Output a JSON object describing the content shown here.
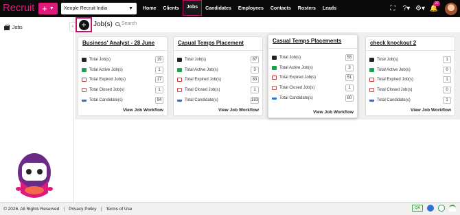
{
  "app": {
    "logo": "Recruit",
    "add_label": "+",
    "org": "Xeople Recruit India"
  },
  "nav": [
    "Home",
    "Clients",
    "Jobs",
    "Candidates",
    "Employees",
    "Contacts",
    "Rosters",
    "Leads"
  ],
  "topbar": {
    "notification_count": "27",
    "help_label": "?"
  },
  "sidebar": {
    "item": "Jobs",
    "collapse_icon": "‹"
  },
  "header": {
    "add_label": "+",
    "title": "Job(s)",
    "search_placeholder": "Search"
  },
  "cards": [
    {
      "title": "Business' Analyst - 28 June",
      "values": [
        "19",
        "1",
        "17",
        "1",
        "94"
      ]
    },
    {
      "title": "Casual Temps Placement",
      "values": [
        "87",
        "3",
        "83",
        "1",
        "183"
      ]
    },
    {
      "title": "Casual Temps Placements",
      "values": [
        "55",
        "3",
        "51",
        "1",
        "80"
      ]
    },
    {
      "title": "check knockout 2",
      "values": [
        "1",
        "0",
        "1",
        "0",
        "1"
      ]
    }
  ],
  "row_labels": [
    "Total Job(s)",
    "Total Active Job(s)",
    "Total Expired Job(s)",
    "Total Closed Job(s)",
    "Total Candidate(s)"
  ],
  "card_action": "View Job Workflow",
  "footer": {
    "copyright": "© 2026. All Rights Reserved",
    "privacy": "Privacy Policy",
    "terms": "Terms of Use",
    "sep": "|",
    "qa": "QA"
  },
  "colors": {
    "brand": "#e0197d",
    "topbar": "#0a0a0a",
    "active_icon": "#1e9e4a",
    "expired_icon": "#d32f2f",
    "candidate_icon": "#2f6fd6"
  }
}
